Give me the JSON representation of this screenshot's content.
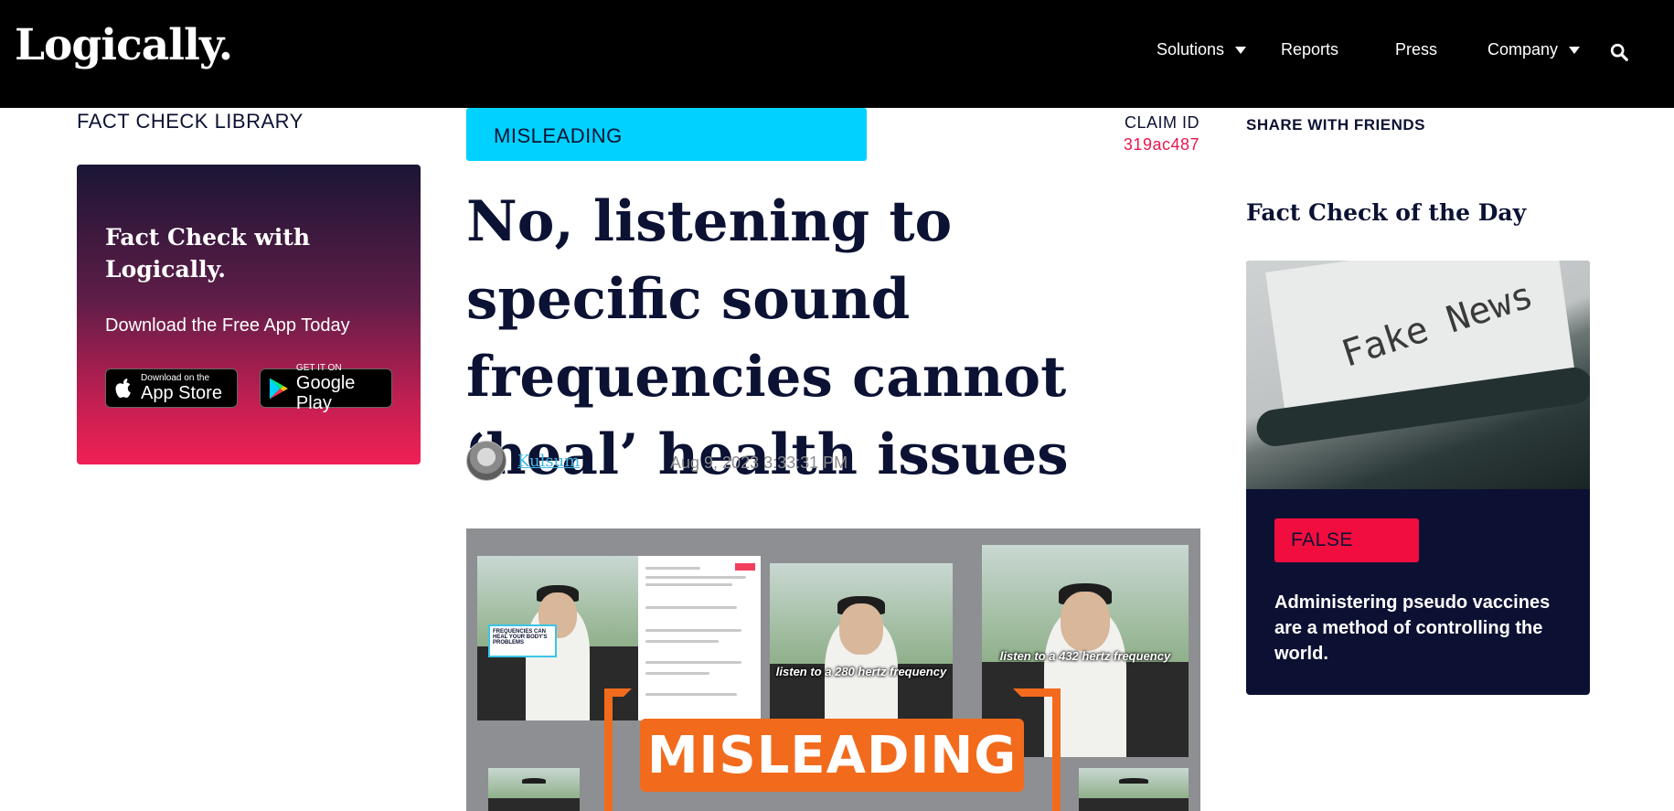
{
  "header": {
    "logo": "Logically.",
    "nav": [
      {
        "label": "Solutions",
        "dropdown": true
      },
      {
        "label": "Reports",
        "dropdown": false
      },
      {
        "label": "Press",
        "dropdown": false
      },
      {
        "label": "Company",
        "dropdown": true
      }
    ],
    "search_icon": "search-icon"
  },
  "sidebar": {
    "title": "FACT CHECK LIBRARY",
    "app_card": {
      "heading": "Fact Check with Logically.",
      "subheading": "Download the Free App Today",
      "app_store": {
        "small": "Download on the",
        "big": "App Store"
      },
      "google_play": {
        "small": "GET IT ON",
        "big": "Google Play"
      }
    }
  },
  "article": {
    "verdict": "MISLEADING",
    "claim_label": "CLAIM ID",
    "claim_id": "319ac487",
    "headline": "No, listening to specific sound frequencies cannot ‘heal’ health issues",
    "author": "Kulsum",
    "date": "Aug 9, 2023 3:33:31 PM",
    "hero": {
      "caption_1": "FREQUENCIES CAN HEAL YOUR BODY'S PROBLEMS",
      "caption_2": "listen to a 280 hertz frequency",
      "caption_3": "listen to a 432 hertz frequency",
      "stamp": "MISLEADING"
    }
  },
  "right": {
    "share": "SHARE WITH FRIENDS",
    "fact_of_day_title": "Fact Check of the Day",
    "card": {
      "image_text": "Fake News",
      "verdict": "FALSE",
      "claim": "Administering pseudo vaccines are a method of controlling the world."
    }
  },
  "colors": {
    "misleading": "#00d1ff",
    "false": "#f20d3f",
    "claim_id": "#e8174f",
    "stamp": "#f26b1d"
  }
}
